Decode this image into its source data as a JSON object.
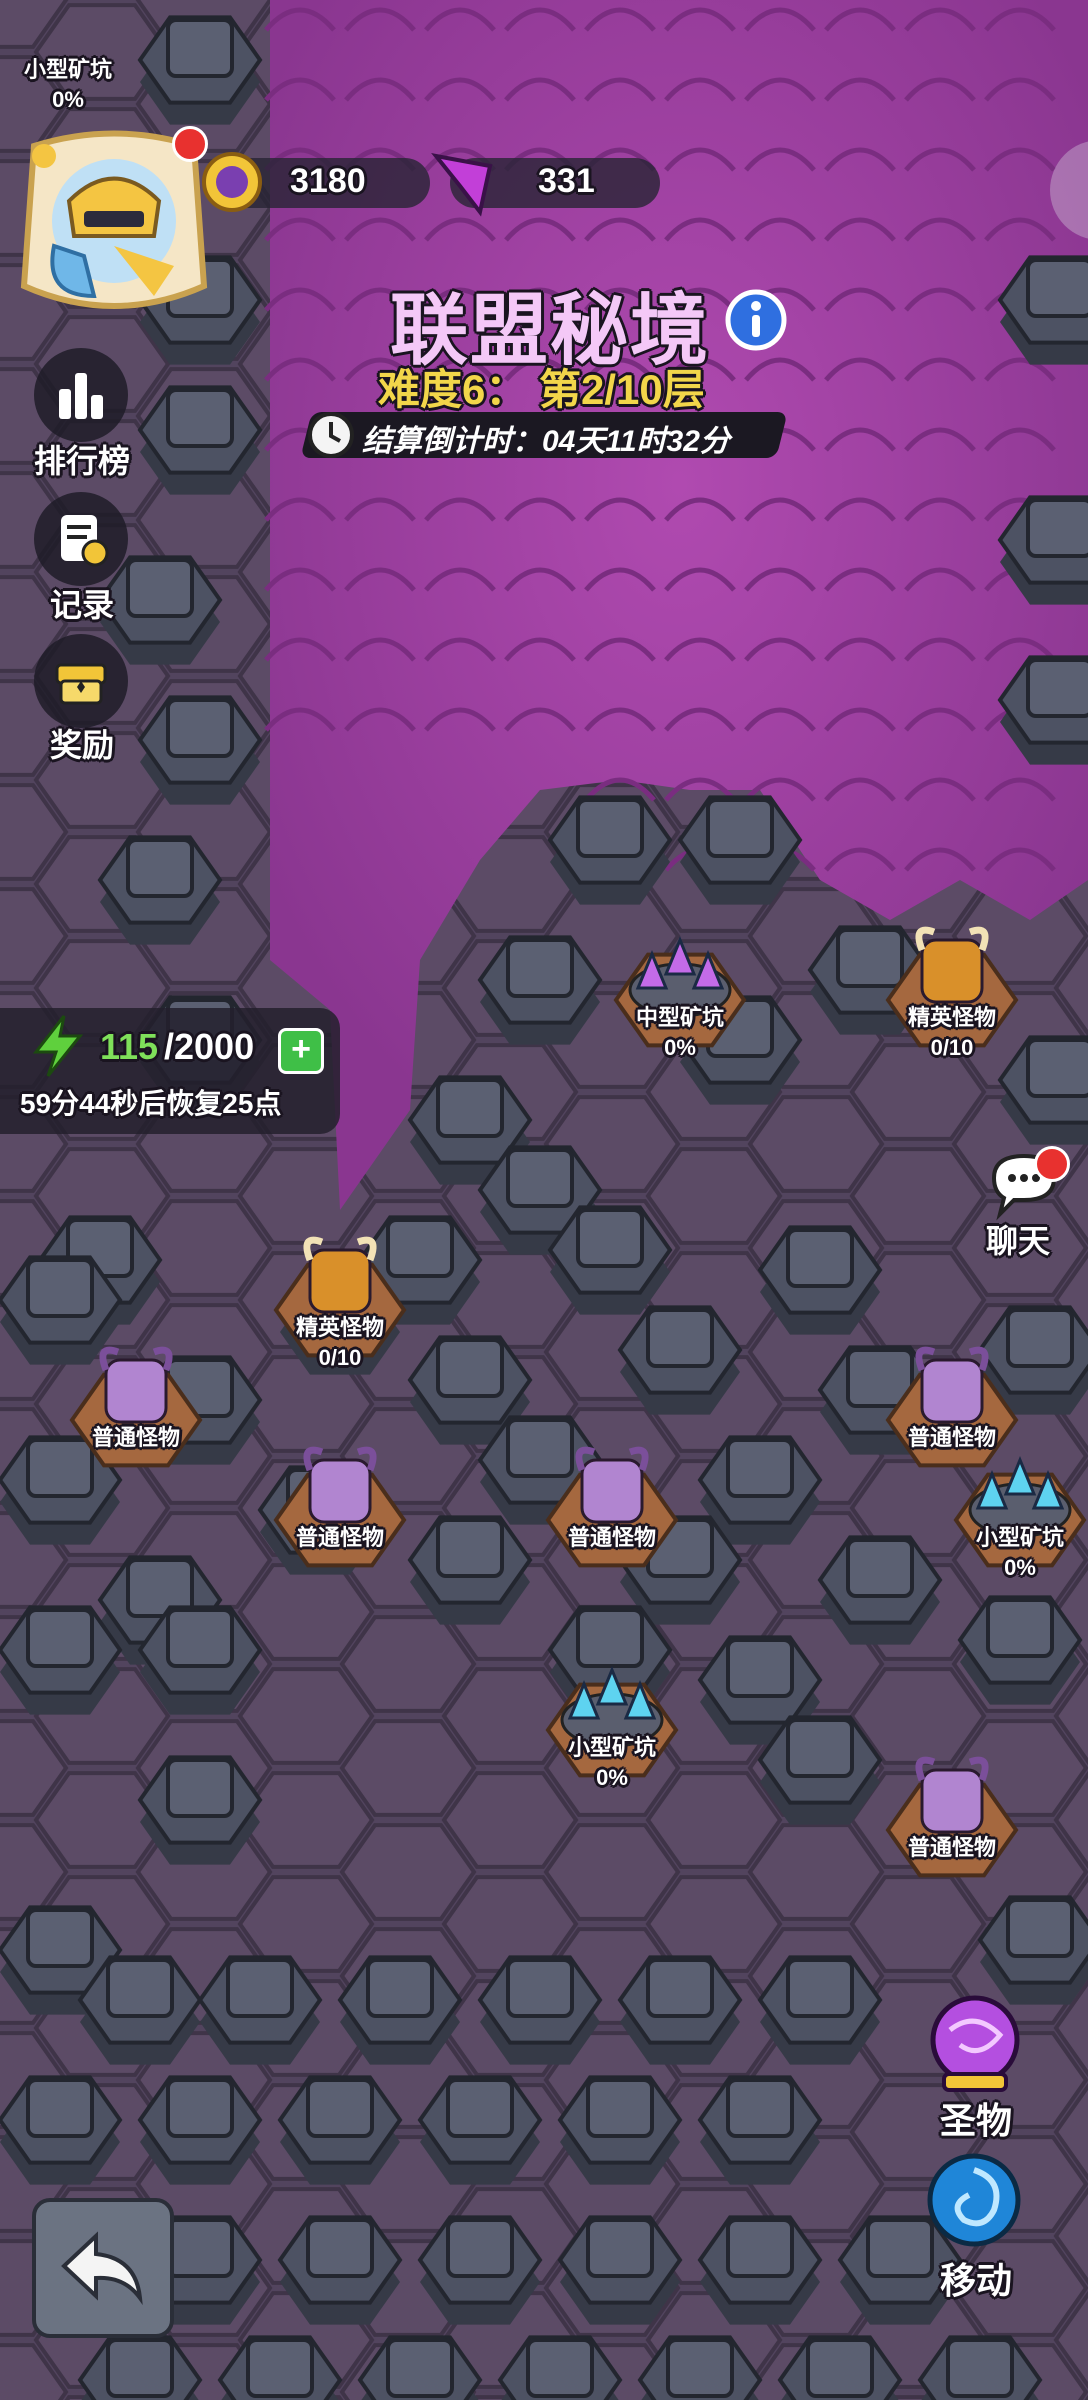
{
  "currency": {
    "coins": "3180",
    "gems": "331"
  },
  "title": "联盟秘境",
  "difficulty": "难度6： 第2/10层",
  "countdown": "结算倒计时：04天11时32分",
  "side_menu": {
    "ranking": "排行榜",
    "records": "记录",
    "rewards": "奖励"
  },
  "energy": {
    "current": "115",
    "max": "/2000",
    "recover": "59分44秒后恢复25点"
  },
  "chat_label": "聊天",
  "relic_label": "圣物",
  "move_label": "移动",
  "tiles": [
    {
      "id": "mine-topleft",
      "name": "小型矿坑",
      "value": "0%",
      "kind": "small-mine"
    },
    {
      "id": "mine-medium",
      "name": "中型矿坑",
      "value": "0%",
      "kind": "medium-mine"
    },
    {
      "id": "elite-1",
      "name": "精英怪物",
      "value": "0/10",
      "kind": "elite"
    },
    {
      "id": "elite-2",
      "name": "精英怪物",
      "value": "0/10",
      "kind": "elite"
    },
    {
      "id": "normal-1",
      "name": "普通怪物",
      "value": "",
      "kind": "normal"
    },
    {
      "id": "normal-2",
      "name": "普通怪物",
      "value": "",
      "kind": "normal"
    },
    {
      "id": "normal-3",
      "name": "普通怪物",
      "value": "",
      "kind": "normal"
    },
    {
      "id": "normal-4",
      "name": "普通怪物",
      "value": "",
      "kind": "normal"
    },
    {
      "id": "mine-small-right",
      "name": "小型矿坑",
      "value": "0%",
      "kind": "small-mine"
    },
    {
      "id": "mine-small-center",
      "name": "小型矿坑",
      "value": "0%",
      "kind": "small-mine"
    },
    {
      "id": "normal-5",
      "name": "普通怪物",
      "value": "",
      "kind": "normal"
    }
  ],
  "colors": {
    "fog": "#9a3f9c",
    "wall": "#4d5263",
    "floor": "#5c4b66",
    "accent": "#f2d64a"
  }
}
